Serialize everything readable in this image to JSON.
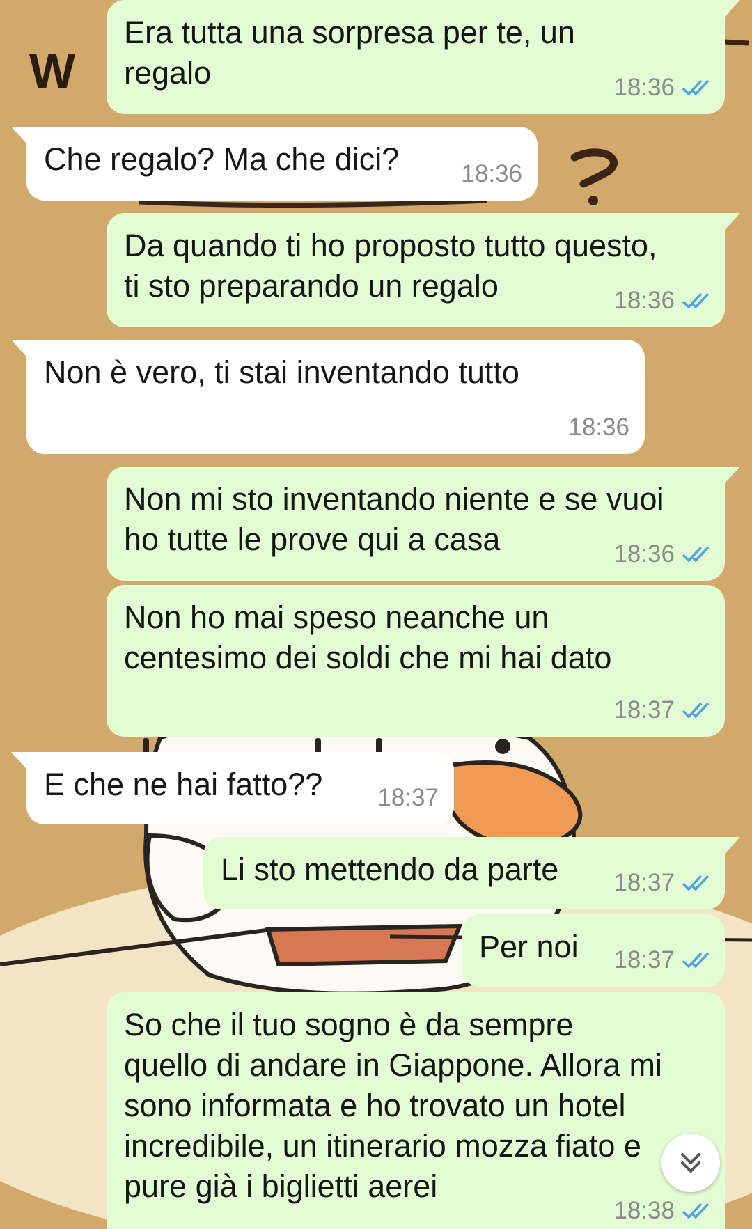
{
  "colors": {
    "wallpaper": "#d2a96a",
    "outgoing_bubble": "#e2fcd4",
    "incoming_bubble": "#ffffff",
    "read_ticks": "#4fa3e0",
    "timestamp": "#8b8b8b"
  },
  "wallpaper": {
    "top_left_text": "W"
  },
  "messages": [
    {
      "direction": "out",
      "text": "Era tutta una sorpresa per te, un\nregalo",
      "time": "18:36",
      "status": "read"
    },
    {
      "direction": "in",
      "text": "Che regalo? Ma che dici?",
      "time": "18:36"
    },
    {
      "direction": "out",
      "text": "Da quando ti ho proposto tutto questo,\nti sto preparando un regalo",
      "time": "18:36",
      "status": "read"
    },
    {
      "direction": "in",
      "text": "Non è vero, ti stai inventando tutto",
      "time": "18:36"
    },
    {
      "direction": "out",
      "text": "Non mi sto inventando niente e se vuoi\nho tutte le prove qui a casa",
      "time": "18:36",
      "status": "read"
    },
    {
      "direction": "out",
      "text": "Non ho mai speso neanche un\ncentesimo dei soldi che mi hai dato",
      "time": "18:37",
      "status": "read"
    },
    {
      "direction": "in",
      "text": "E che ne hai fatto??",
      "time": "18:37"
    },
    {
      "direction": "out",
      "text": "Li sto mettendo da parte",
      "time": "18:37",
      "status": "read"
    },
    {
      "direction": "out",
      "text": "Per noi",
      "time": "18:37",
      "status": "read"
    },
    {
      "direction": "out",
      "text": "So che il tuo sogno è da sempre\nquello di andare in Giappone. Allora mi\nsono informata e ho trovato un hotel\nincredibile, un itinerario mozza fiato e\npure già i biglietti aerei",
      "time": "18:38",
      "status": "read"
    }
  ],
  "scroll_button": {
    "icon": "double-chevron-down-icon"
  }
}
